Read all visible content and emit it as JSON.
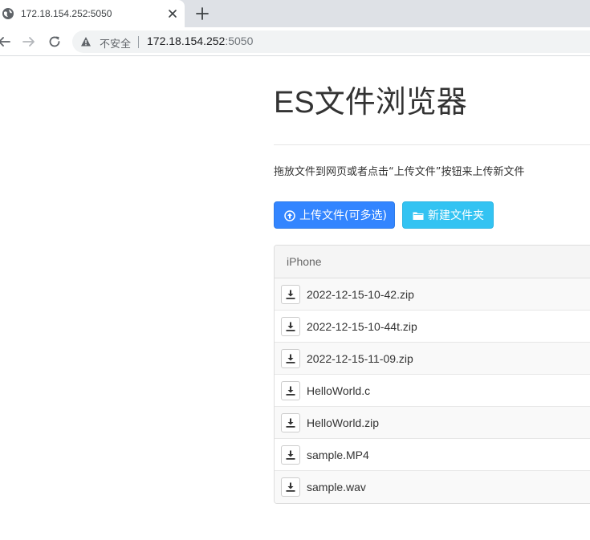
{
  "browser": {
    "tab": {
      "title": "172.18.154.252:5050"
    },
    "omnibox": {
      "security_label": "不安全",
      "url_host": "172.18.154.252",
      "url_port": ":5050"
    }
  },
  "page": {
    "title": "ES文件浏览器",
    "hint": "拖放文件到网页或者点击“上传文件”按钮来上传新文件",
    "buttons": {
      "upload_label": "上传文件(可多选)",
      "new_folder_label": "新建文件夹"
    },
    "panel": {
      "heading": "iPhone",
      "files": [
        {
          "name": "2022-12-15-10-42.zip"
        },
        {
          "name": "2022-12-15-10-44t.zip"
        },
        {
          "name": "2022-12-15-11-09.zip"
        },
        {
          "name": "HelloWorld.c"
        },
        {
          "name": "HelloWorld.zip"
        },
        {
          "name": "sample.MP4"
        },
        {
          "name": "sample.wav"
        }
      ]
    }
  },
  "colors": {
    "upload_button": "#3385ff",
    "new_folder_button": "#33c3f2",
    "panel_heading_bg": "#f5f5f5",
    "stripe_bg": "#f9f9f9"
  },
  "icons": {
    "favicon": "globe-icon",
    "tab_close": "close-icon",
    "new_tab": "plus-icon",
    "back": "arrow-left-icon",
    "forward": "arrow-right-icon",
    "reload": "reload-icon",
    "security": "warning-icon",
    "upload": "upload-circle-icon",
    "folder": "folder-icon",
    "download": "download-icon"
  }
}
